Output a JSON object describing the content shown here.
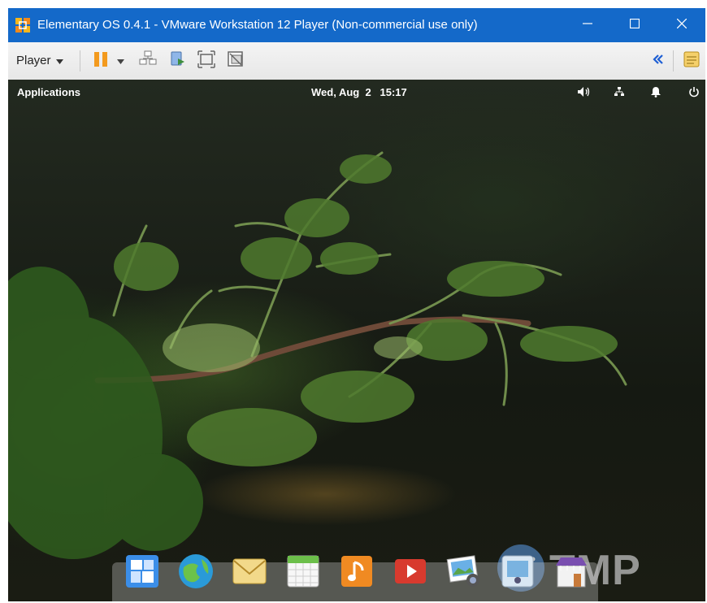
{
  "window": {
    "title": "Elementary OS 0.4.1 - VMware Workstation 12 Player (Non-commercial use only)",
    "controls": [
      "minimize-icon",
      "maximize-icon",
      "close-icon"
    ]
  },
  "toolbar": {
    "player_label": "Player",
    "icons": [
      "pause-icon",
      "dropdown-arrow-icon",
      "send-ctrl-alt-del-icon",
      "removable-devices-icon",
      "fullscreen-icon",
      "unity-icon",
      "collapse-icon",
      "notes-icon"
    ]
  },
  "panel": {
    "applications_label": "Applications",
    "clock": "Wed, Aug  2   15:17",
    "indicators": [
      "volume-icon",
      "network-icon",
      "notification-bell-icon",
      "power-icon"
    ]
  },
  "dock": {
    "apps": [
      "multitasking-view-icon",
      "web-browser-icon",
      "mail-icon",
      "calendar-icon",
      "music-icon",
      "videos-icon",
      "photos-icon",
      "system-settings-icon",
      "app-center-icon"
    ]
  },
  "watermark": {
    "text": "TMP"
  },
  "colors": {
    "titlebar": "#1469c9",
    "toolbar": "#ececec",
    "pause_icon": "#f39a1e",
    "collapse_icon": "#1e5fd4"
  }
}
